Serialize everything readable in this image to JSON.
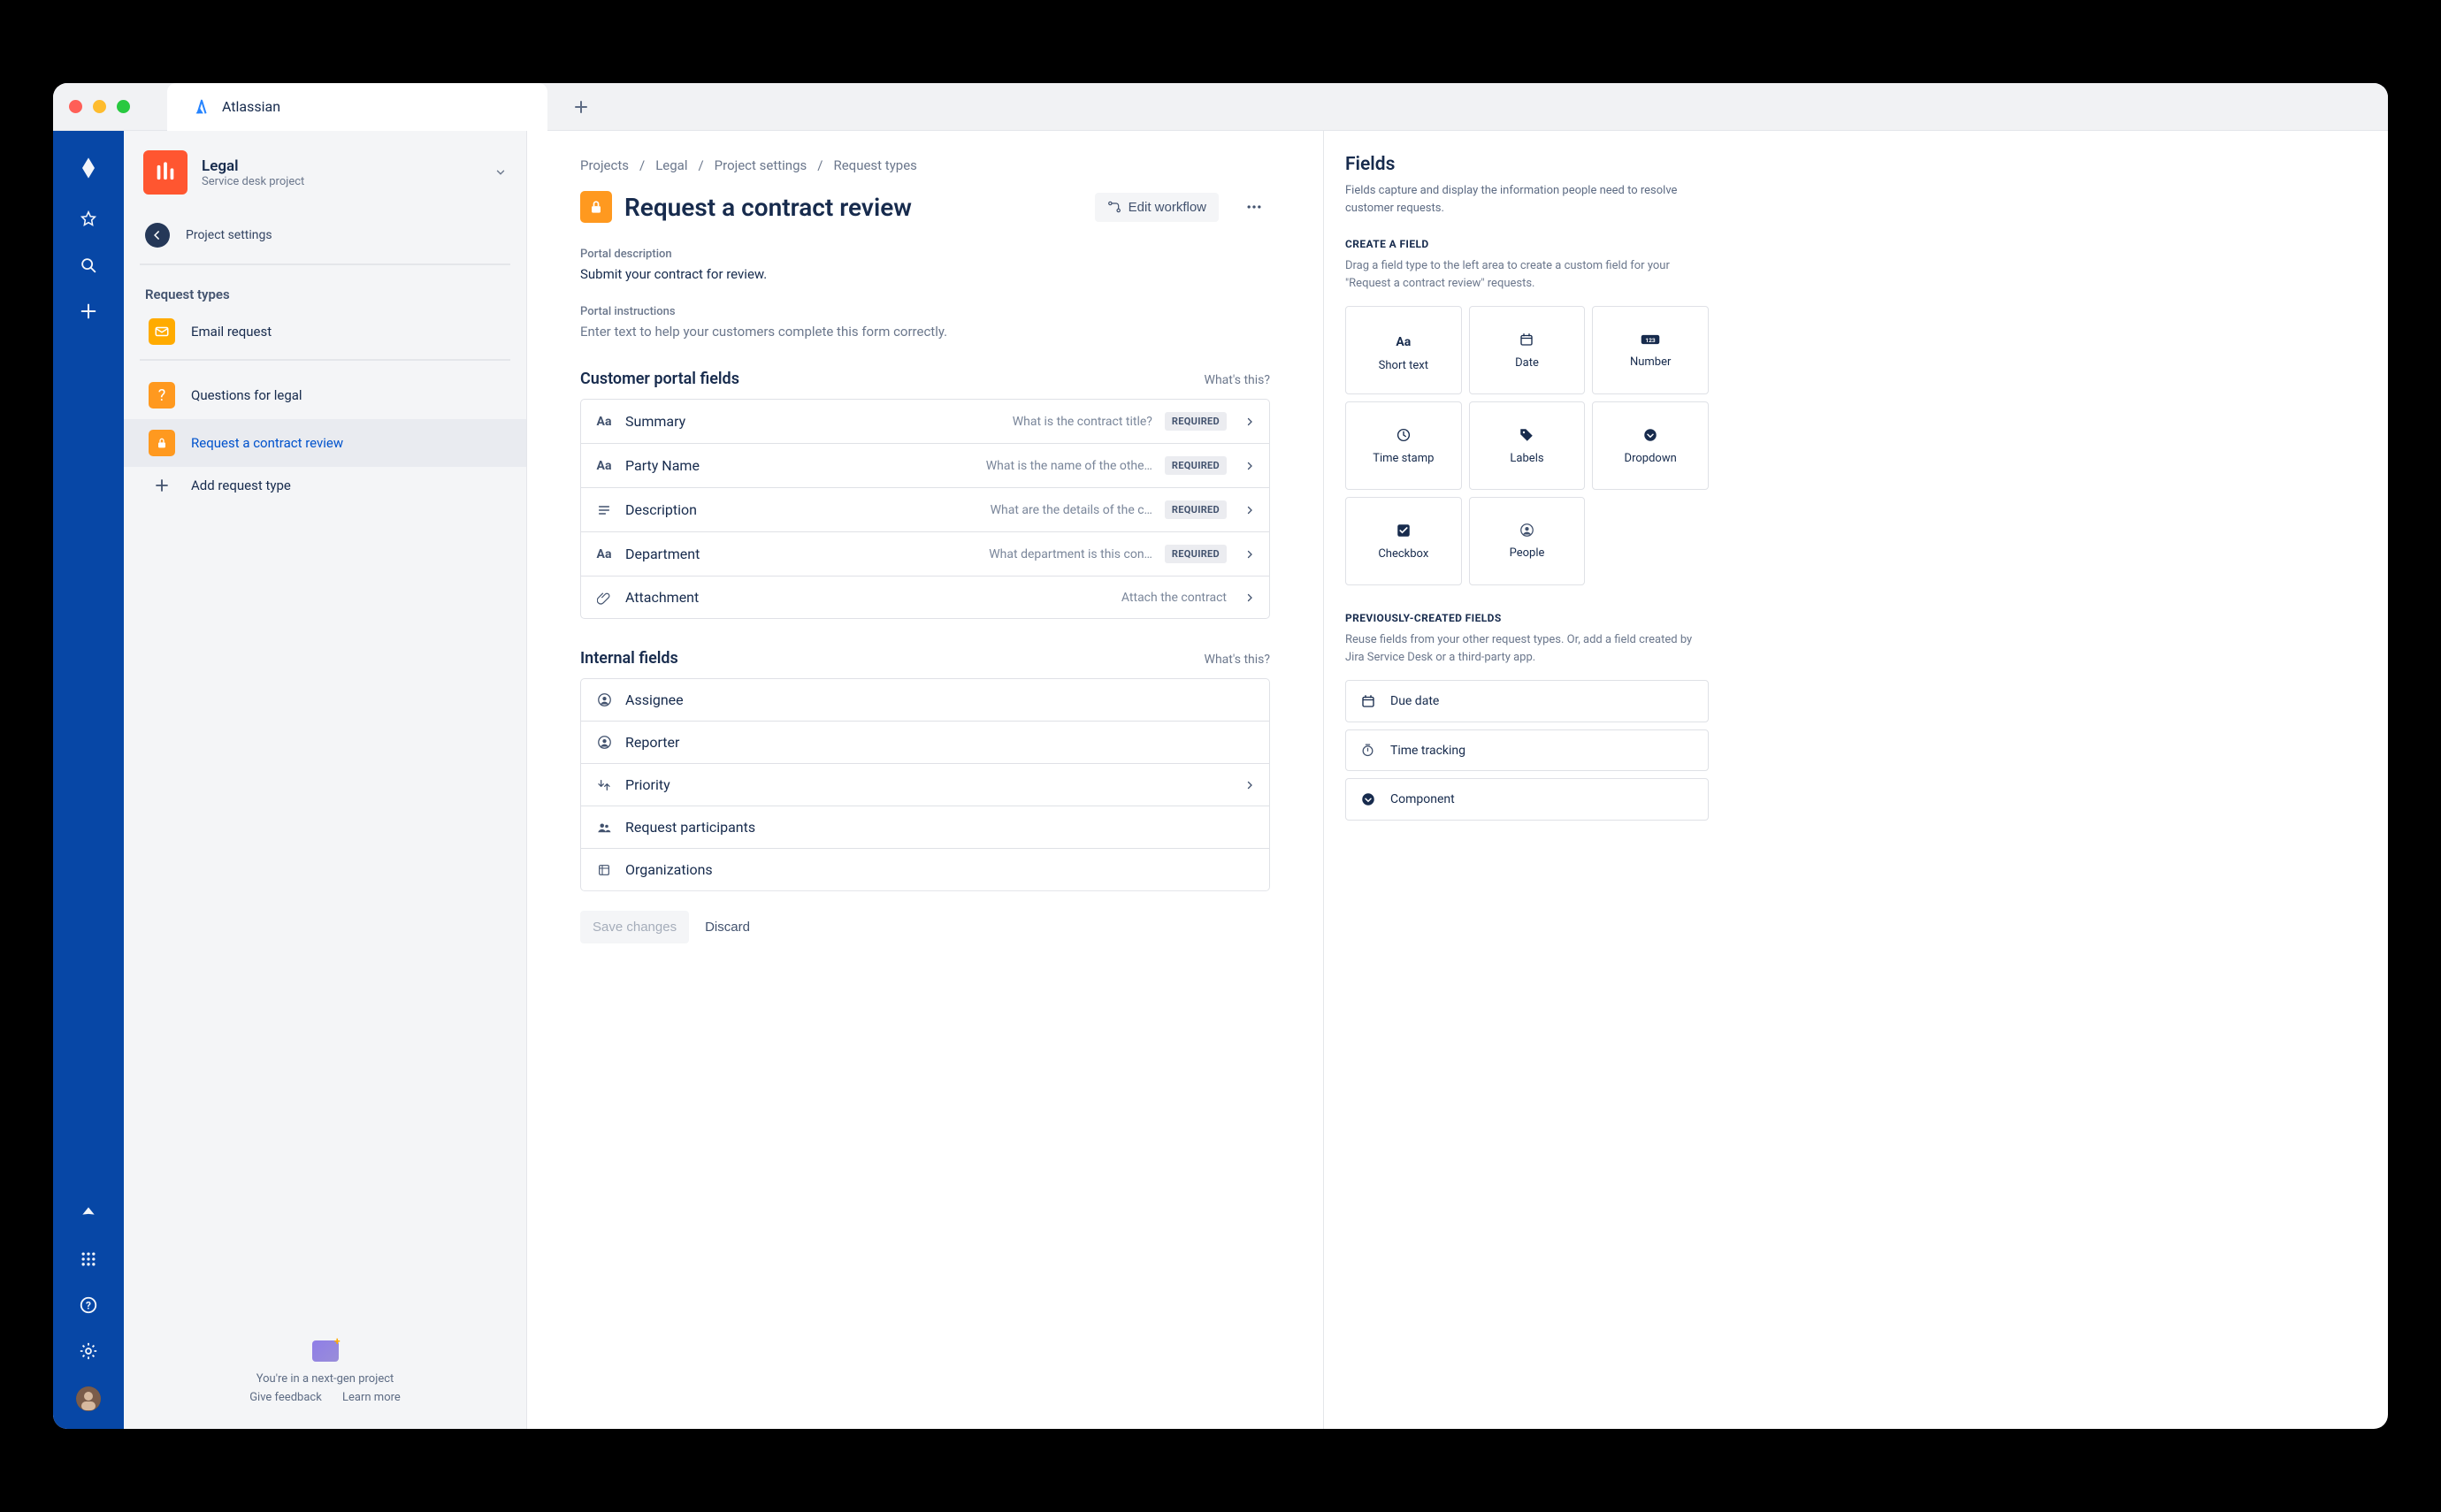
{
  "tab": {
    "title": "Atlassian"
  },
  "project": {
    "name": "Legal",
    "subtitle": "Service desk project",
    "settings_label": "Project settings"
  },
  "sidebar": {
    "section_label": "Request types",
    "items": [
      {
        "label": "Email request",
        "icon": "mail",
        "color": "mustard"
      },
      {
        "label": "Questions for legal",
        "icon": "question",
        "color": "orange"
      },
      {
        "label": "Request a contract review",
        "icon": "lock",
        "color": "orange",
        "active": true
      }
    ],
    "add_label": "Add request type",
    "footer_line": "You're in a next-gen project",
    "footer_feedback": "Give feedback",
    "footer_learn": "Learn more"
  },
  "breadcrumb": [
    "Projects",
    "Legal",
    "Project settings",
    "Request types"
  ],
  "page": {
    "title": "Request a contract review",
    "edit_workflow": "Edit workflow",
    "portal_desc_label": "Portal description",
    "portal_desc_value": "Submit your contract for review.",
    "portal_instr_label": "Portal instructions",
    "portal_instr_placeholder": "Enter text to help your customers complete this form correctly.",
    "portal_fields_heading": "Customer portal fields",
    "internal_fields_heading": "Internal fields",
    "whats_this": "What's this?",
    "save": "Save changes",
    "discard": "Discard"
  },
  "portal_fields": [
    {
      "icon": "Aa",
      "name": "Summary",
      "helper": "What is the contract title?",
      "required": true,
      "chev": true
    },
    {
      "icon": "Aa",
      "name": "Party Name",
      "helper": "What is the name of the othe…",
      "required": true,
      "chev": true
    },
    {
      "icon": "desc",
      "name": "Description",
      "helper": "What are the details of the c…",
      "required": true,
      "chev": true
    },
    {
      "icon": "Aa",
      "name": "Department",
      "helper": "What department is this con…",
      "required": true,
      "chev": true
    },
    {
      "icon": "attach",
      "name": "Attachment",
      "helper": "Attach the contract",
      "required": false,
      "chev": true
    }
  ],
  "internal_fields": [
    {
      "icon": "person",
      "name": "Assignee",
      "chev": false
    },
    {
      "icon": "person",
      "name": "Reporter",
      "chev": false
    },
    {
      "icon": "priority",
      "name": "Priority",
      "chev": true
    },
    {
      "icon": "people",
      "name": "Request participants",
      "chev": false
    },
    {
      "icon": "org",
      "name": "Organizations",
      "chev": false
    }
  ],
  "right": {
    "title": "Fields",
    "desc": "Fields capture and display the information people need to resolve customer requests.",
    "create_heading": "CREATE A FIELD",
    "create_desc": "Drag a field type to the left area to create a custom field for your \"Request a contract review\" requests.",
    "field_types": [
      {
        "label": "Short text",
        "icon": "Aa"
      },
      {
        "label": "Date",
        "icon": "cal"
      },
      {
        "label": "Number",
        "icon": "num"
      },
      {
        "label": "Time stamp",
        "icon": "clock"
      },
      {
        "label": "Labels",
        "icon": "tag"
      },
      {
        "label": "Dropdown",
        "icon": "dd"
      },
      {
        "label": "Checkbox",
        "icon": "check"
      },
      {
        "label": "People",
        "icon": "person"
      }
    ],
    "prev_heading": "PREVIOUSLY-CREATED FIELDS",
    "prev_desc": "Reuse fields from your other request types. Or, add a field created by Jira Service Desk or a third-party app.",
    "prev_fields": [
      {
        "label": "Due date",
        "icon": "cal"
      },
      {
        "label": "Time tracking",
        "icon": "timer"
      },
      {
        "label": "Component",
        "icon": "dd"
      }
    ]
  },
  "required_label": "REQUIRED"
}
